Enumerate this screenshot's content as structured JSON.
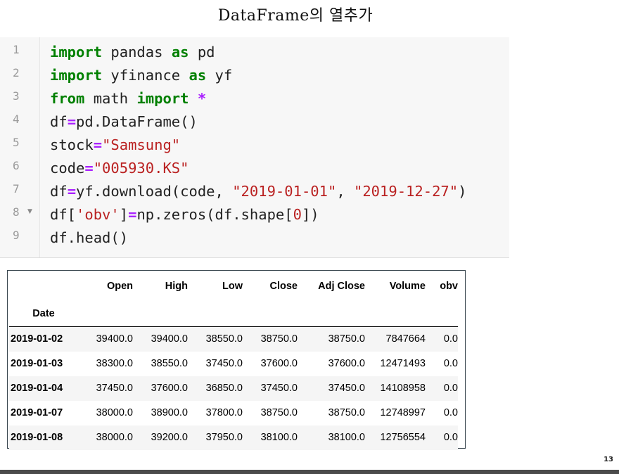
{
  "slide": {
    "title": "DataFrame의 열추가",
    "page_number": "13"
  },
  "code": {
    "lines": [
      {
        "number": "1",
        "tokens": [
          {
            "t": "import",
            "c": "kw"
          },
          {
            "t": " pandas ",
            "c": "nm"
          },
          {
            "t": "as",
            "c": "kw"
          },
          {
            "t": " pd",
            "c": "nm"
          }
        ]
      },
      {
        "number": "2",
        "tokens": [
          {
            "t": "import",
            "c": "kw"
          },
          {
            "t": " yfinance ",
            "c": "nm"
          },
          {
            "t": "as",
            "c": "kw"
          },
          {
            "t": " yf",
            "c": "nm"
          }
        ]
      },
      {
        "number": "3",
        "tokens": [
          {
            "t": "from",
            "c": "kw"
          },
          {
            "t": " math ",
            "c": "nm"
          },
          {
            "t": "import",
            "c": "kw"
          },
          {
            "t": " ",
            "c": "nm"
          },
          {
            "t": "*",
            "c": "op"
          }
        ]
      },
      {
        "number": "4",
        "tokens": [
          {
            "t": "df",
            "c": "nm"
          },
          {
            "t": "=",
            "c": "op"
          },
          {
            "t": "pd.DataFrame()",
            "c": "nm"
          }
        ]
      },
      {
        "number": "5",
        "tokens": [
          {
            "t": "stock",
            "c": "nm"
          },
          {
            "t": "=",
            "c": "op"
          },
          {
            "t": "\"Samsung\"",
            "c": "str"
          }
        ]
      },
      {
        "number": "6",
        "tokens": [
          {
            "t": "code",
            "c": "nm"
          },
          {
            "t": "=",
            "c": "op"
          },
          {
            "t": "\"005930.KS\"",
            "c": "str"
          }
        ]
      },
      {
        "number": "7",
        "tokens": [
          {
            "t": "df",
            "c": "nm"
          },
          {
            "t": "=",
            "c": "op"
          },
          {
            "t": "yf.download(code, ",
            "c": "nm"
          },
          {
            "t": "\"2019-01-01\"",
            "c": "str"
          },
          {
            "t": ", ",
            "c": "nm"
          },
          {
            "t": "\"2019-12-27\"",
            "c": "str"
          },
          {
            "t": ")",
            "c": "nm"
          }
        ]
      },
      {
        "number": "8",
        "fold": true,
        "tokens": [
          {
            "t": "df[",
            "c": "nm"
          },
          {
            "t": "'obv'",
            "c": "str"
          },
          {
            "t": "]",
            "c": "nm"
          },
          {
            "t": "=",
            "c": "op"
          },
          {
            "t": "np.zeros(df.shape[",
            "c": "nm"
          },
          {
            "t": "0",
            "c": "str"
          },
          {
            "t": "])",
            "c": "nm"
          }
        ]
      },
      {
        "number": "9",
        "tokens": [
          {
            "t": "df.head()",
            "c": "nm"
          }
        ]
      }
    ],
    "fold_icon": "chevron-down-icon"
  },
  "dataframe": {
    "columns": [
      "Open",
      "High",
      "Low",
      "Close",
      "Adj Close",
      "Volume",
      "obv"
    ],
    "index_name": "Date",
    "rows": [
      {
        "date": "2019-01-02",
        "values": [
          "39400.0",
          "39400.0",
          "38550.0",
          "38750.0",
          "38750.0",
          "7847664",
          "0.0"
        ]
      },
      {
        "date": "2019-01-03",
        "values": [
          "38300.0",
          "38550.0",
          "37450.0",
          "37600.0",
          "37600.0",
          "12471493",
          "0.0"
        ]
      },
      {
        "date": "2019-01-04",
        "values": [
          "37450.0",
          "37600.0",
          "36850.0",
          "37450.0",
          "37450.0",
          "14108958",
          "0.0"
        ]
      },
      {
        "date": "2019-01-07",
        "values": [
          "38000.0",
          "38900.0",
          "37800.0",
          "38750.0",
          "38750.0",
          "12748997",
          "0.0"
        ]
      },
      {
        "date": "2019-01-08",
        "values": [
          "38000.0",
          "39200.0",
          "37950.0",
          "38100.0",
          "38100.0",
          "12756554",
          "0.0"
        ]
      }
    ]
  },
  "colors": {
    "keyword": "#008000",
    "operator": "#aa22ff",
    "string": "#ba2121",
    "editor_bg": "#f7f7f7"
  }
}
